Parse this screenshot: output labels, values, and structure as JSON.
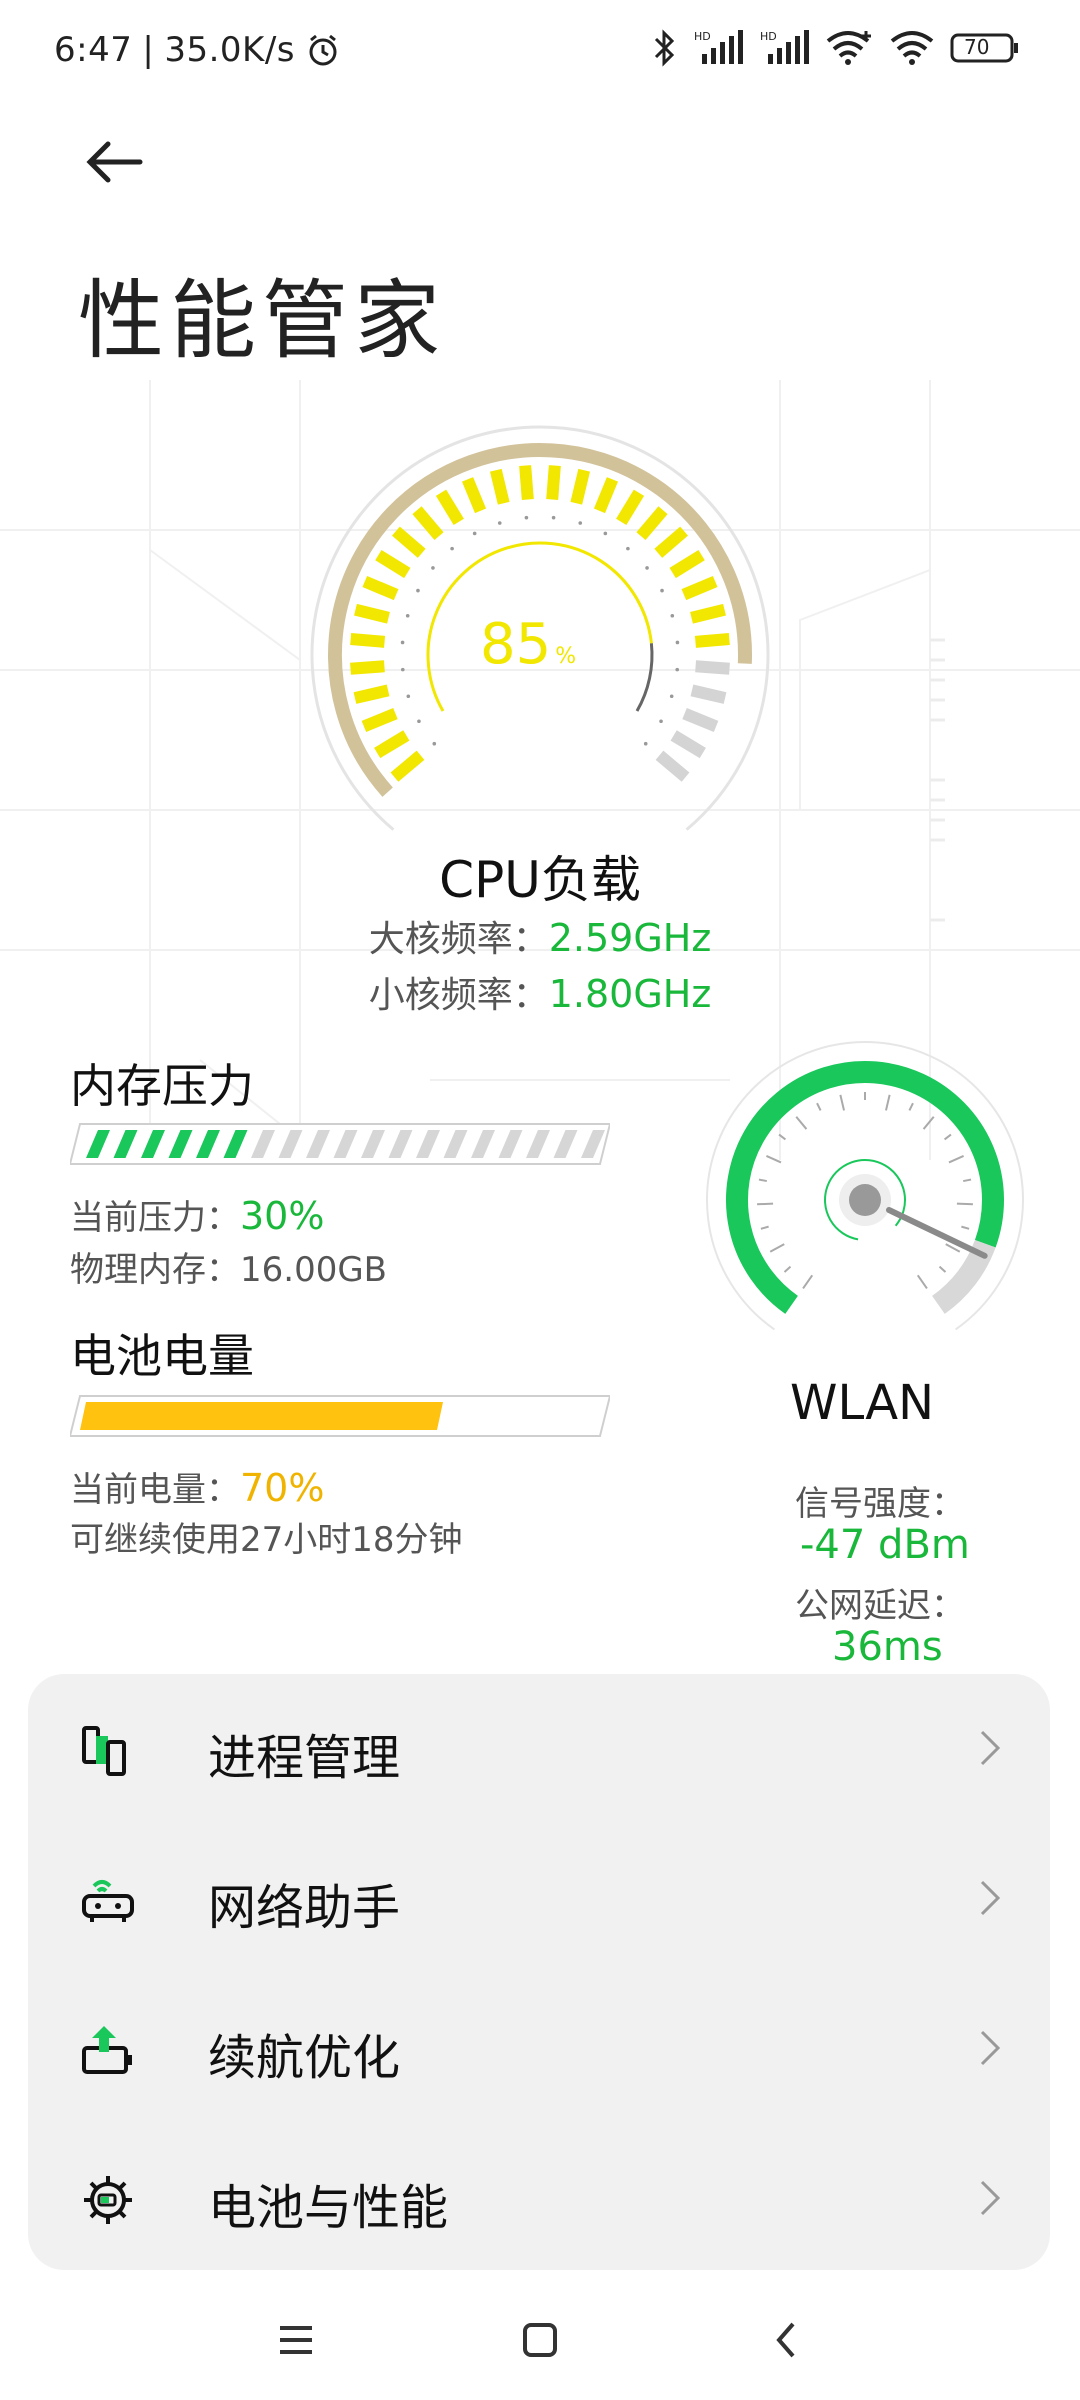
{
  "status_bar": {
    "time": "6:47",
    "speed": "35.0K/s",
    "battery_level": "70",
    "icons": [
      "alarm-icon",
      "bluetooth-icon",
      "signal-hd-icon",
      "signal-hd-icon",
      "wifi-plus-icon",
      "wifi-icon",
      "battery-icon"
    ]
  },
  "header": {
    "title": "性能管家"
  },
  "cpu": {
    "percent": "85",
    "percent_unit": "%",
    "load_fraction": 0.85,
    "label": "CPU负载",
    "big_core_label": "大核频率：",
    "big_core_value": "2.59GHz",
    "small_core_label": "小核频率：",
    "small_core_value": "1.80GHz",
    "accent_color": "#f1e700"
  },
  "memory": {
    "title": "内存压力",
    "pressure_label": "当前压力：",
    "pressure_value": "30%",
    "pressure_fraction": 0.3,
    "physical_label": "物理内存：",
    "physical_value": "16.00GB"
  },
  "battery": {
    "title": "电池电量",
    "level_label": "当前电量：",
    "level_value": "70%",
    "level_fraction": 0.7,
    "remaining_text": "可继续使用27小时18分钟",
    "bar_color": "#ffc20e"
  },
  "wlan": {
    "label": "WLAN",
    "signal_label": "信号强度：",
    "signal_value": "-47 dBm",
    "latency_label": "公网延迟：",
    "latency_value": "36ms",
    "accent_color": "#19c75b"
  },
  "menu": {
    "items": [
      {
        "label": "进程管理",
        "icon": "process-icon"
      },
      {
        "label": "网络助手",
        "icon": "router-icon"
      },
      {
        "label": "续航优化",
        "icon": "battery-boost-icon"
      },
      {
        "label": "电池与性能",
        "icon": "gear-battery-icon"
      }
    ]
  },
  "navbar": {
    "icons": [
      "menu-icon",
      "home-icon",
      "back-nav-icon"
    ]
  }
}
